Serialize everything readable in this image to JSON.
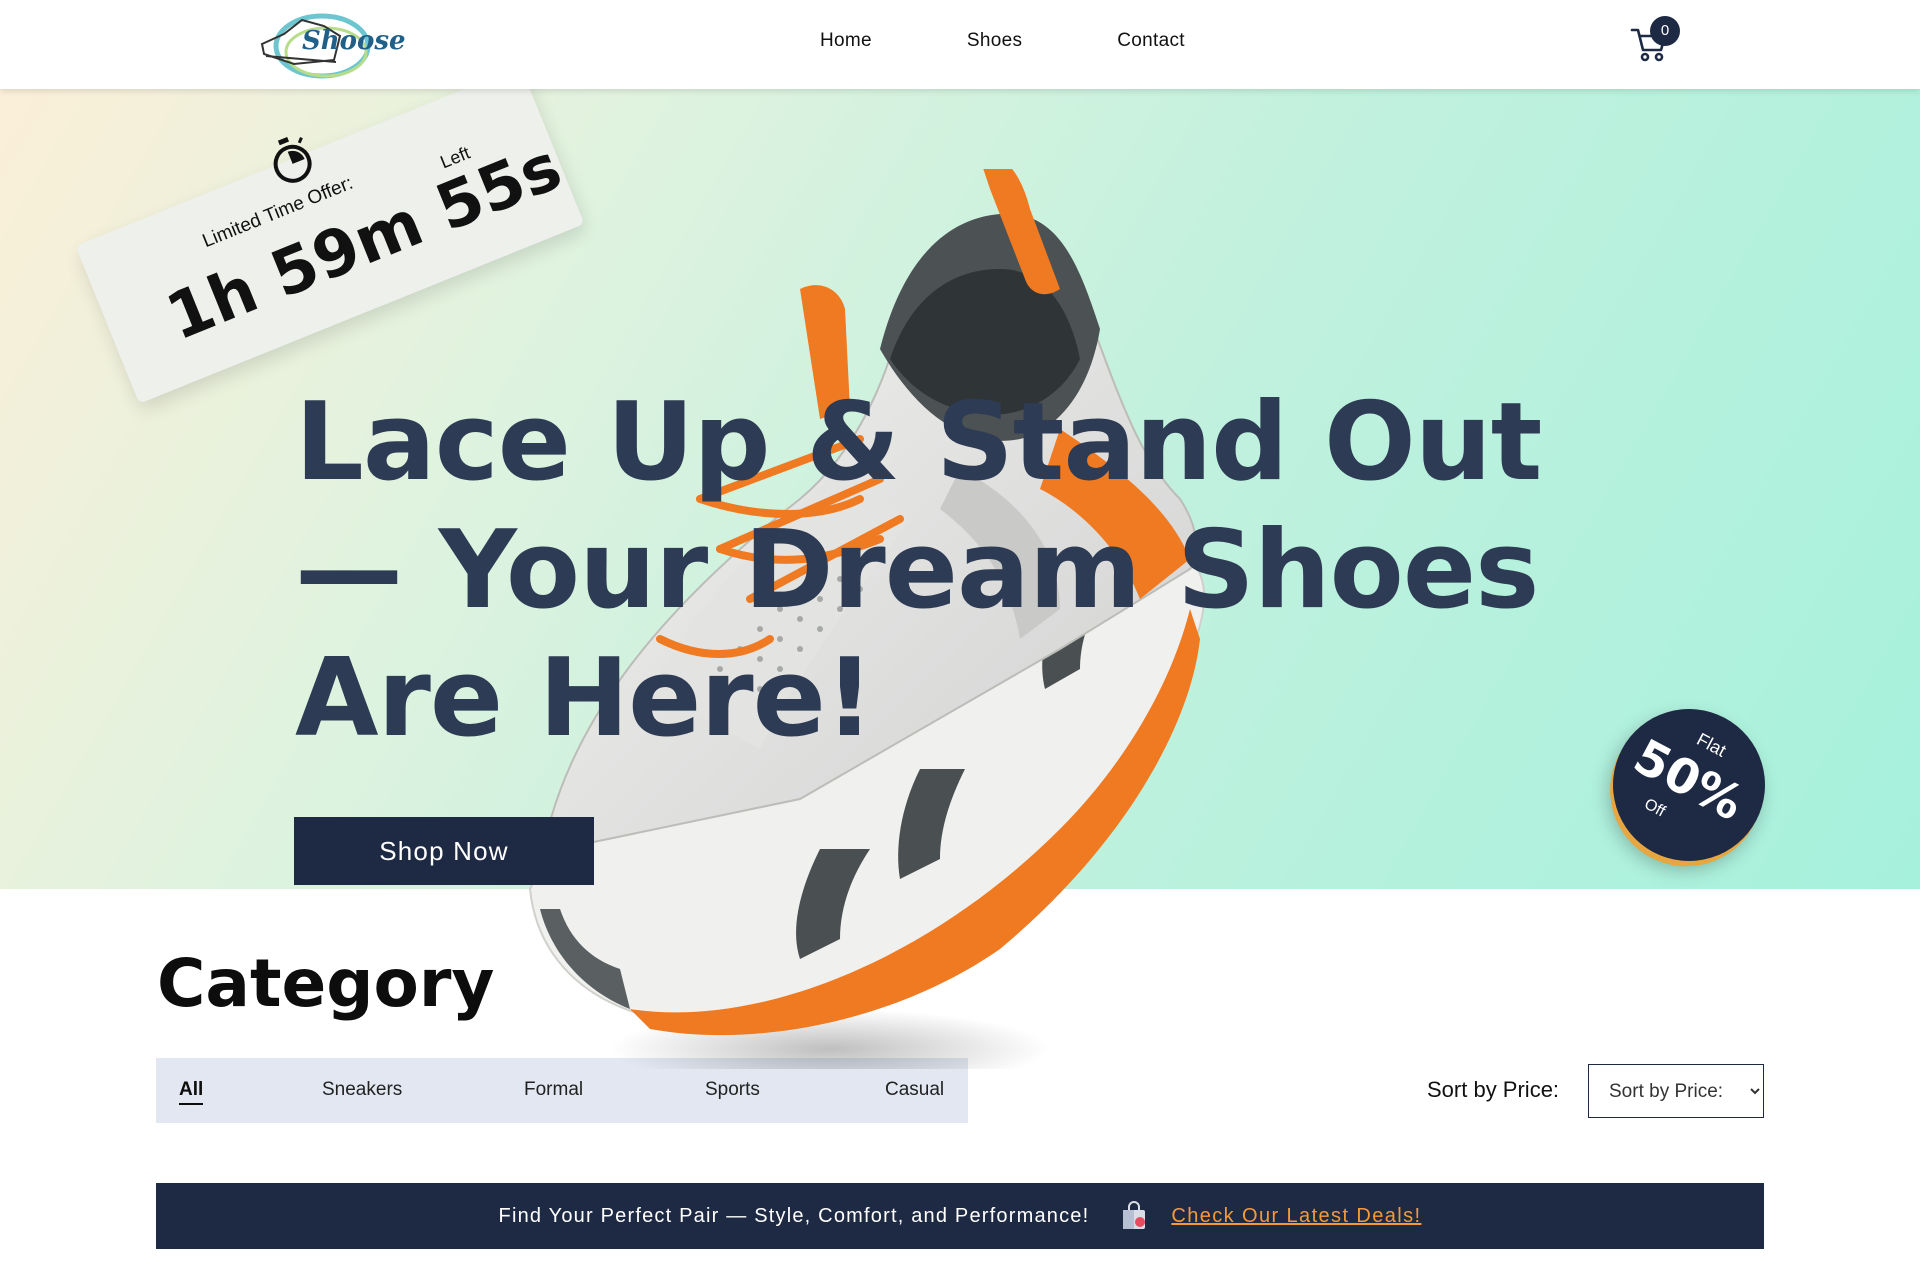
{
  "header": {
    "logo_text": "Shoose",
    "nav": [
      "Home",
      "Shoes",
      "Contact"
    ],
    "cart_count": "0"
  },
  "timer": {
    "label": "Limited Time Offer:",
    "time": "1h 59m 55s",
    "suffix": "Left"
  },
  "hero": {
    "title": "Lace Up & Stand Out — Your Dream Shoes Are Here!",
    "cta": "Shop Now"
  },
  "badge": {
    "flat": "Flat",
    "percent": "50%",
    "off": "Off"
  },
  "category": {
    "title": "Category",
    "items": [
      "All",
      "Sneakers",
      "Formal",
      "Sports",
      "Casual"
    ],
    "active": "All"
  },
  "sort": {
    "label": "Sort by Price:",
    "selected": "Sort by Price:"
  },
  "banner": {
    "text": "Find Your Perfect Pair — Style, Comfort, and Performance!",
    "link": "Check Our Latest Deals!"
  },
  "colors": {
    "navy": "#1e2a44",
    "title_navy": "#2e3b54",
    "orange": "#f59a35",
    "mint": "#a6f1dc",
    "cream": "#fbefd8"
  }
}
